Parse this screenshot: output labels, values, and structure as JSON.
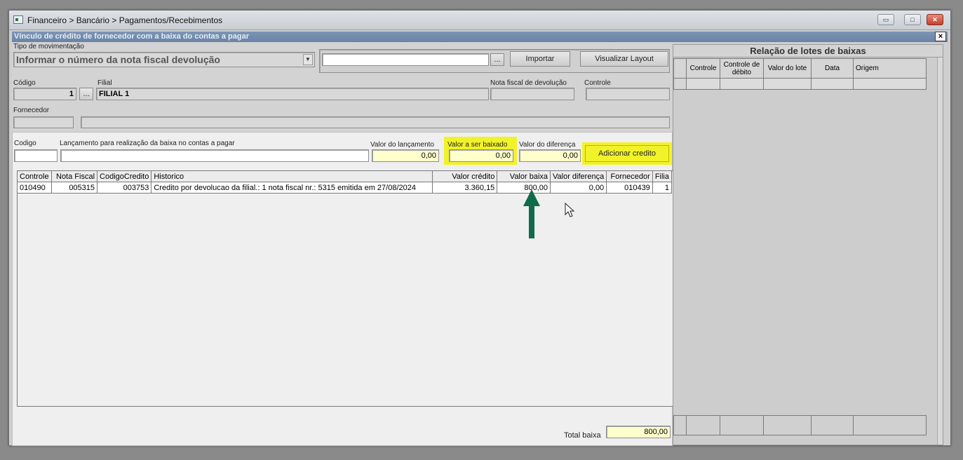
{
  "window": {
    "title": "Financeiro > Bancário > Pagamentos/Recebimentos"
  },
  "panel": {
    "title": "Vínculo de crédito de fornecedor com a baixa do contas a pagar",
    "close_glyph": "×"
  },
  "header_form": {
    "tipo_label": "Tipo de movimentação",
    "tipo_value": "Informar o número da nota fiscal devolução",
    "file_value": "",
    "browse_label": "...",
    "importar_label": "Importar",
    "visualizar_label": "Visualizar Layout",
    "codigo_label": "Código",
    "codigo_value": "1",
    "codigo_browse": "...",
    "filial_label": "Filial",
    "filial_value": "FILIAL 1",
    "nota_label": "Nota fiscal de devolução",
    "nota_value": "",
    "controle_label": "Controle",
    "controle_value": "",
    "fornecedor_label": "Fornecedor",
    "fornecedor_code": "",
    "fornecedor_name": ""
  },
  "entry_form": {
    "codigo_label": "Codigo",
    "codigo_value": "",
    "lancamento_label": "Lançamento para realização da baixa no contas a pagar",
    "lancamento_value": "",
    "valor_lancamento_label": "Valor do lançamento",
    "valor_lancamento_value": "0,00",
    "valor_baixado_label": "Valor a ser baixado",
    "valor_baixado_value": "0,00",
    "valor_diferenca_label": "Valor do diferença",
    "valor_diferenca_value": "0,00",
    "adicionar_label": "Adicionar credito"
  },
  "credits_table": {
    "columns": [
      "Controle",
      "Nota Fiscal",
      "CodigoCredito",
      "Historico",
      "Valor crédito",
      "Valor baixa",
      "Valor diferença",
      "Fornecedor",
      "Filia"
    ],
    "rows": [
      [
        "010490",
        "005315",
        "003753",
        "Credito por devolucao da filial.: 1 nota fiscal  nr.: 5315 emitida em 27/08/2024",
        "3.360,15",
        "800,00",
        "0,00",
        "010439",
        "1"
      ]
    ]
  },
  "totals": {
    "total_baixa_label": "Total baixa",
    "total_baixa_value": "800,00"
  },
  "lotes_panel": {
    "title": "Relação de lotes de baixas",
    "columns": [
      "Controle",
      "Controle de débito",
      "Valor do lote",
      "Data",
      "Origem"
    ]
  },
  "colors": {
    "highlight": "#f2f22a",
    "arrow": "#0f6b4a",
    "panel_bar": "#7088aa"
  },
  "icons": {
    "arrow": "up-arrow-icon",
    "cursor": "mouse-pointer-icon"
  }
}
